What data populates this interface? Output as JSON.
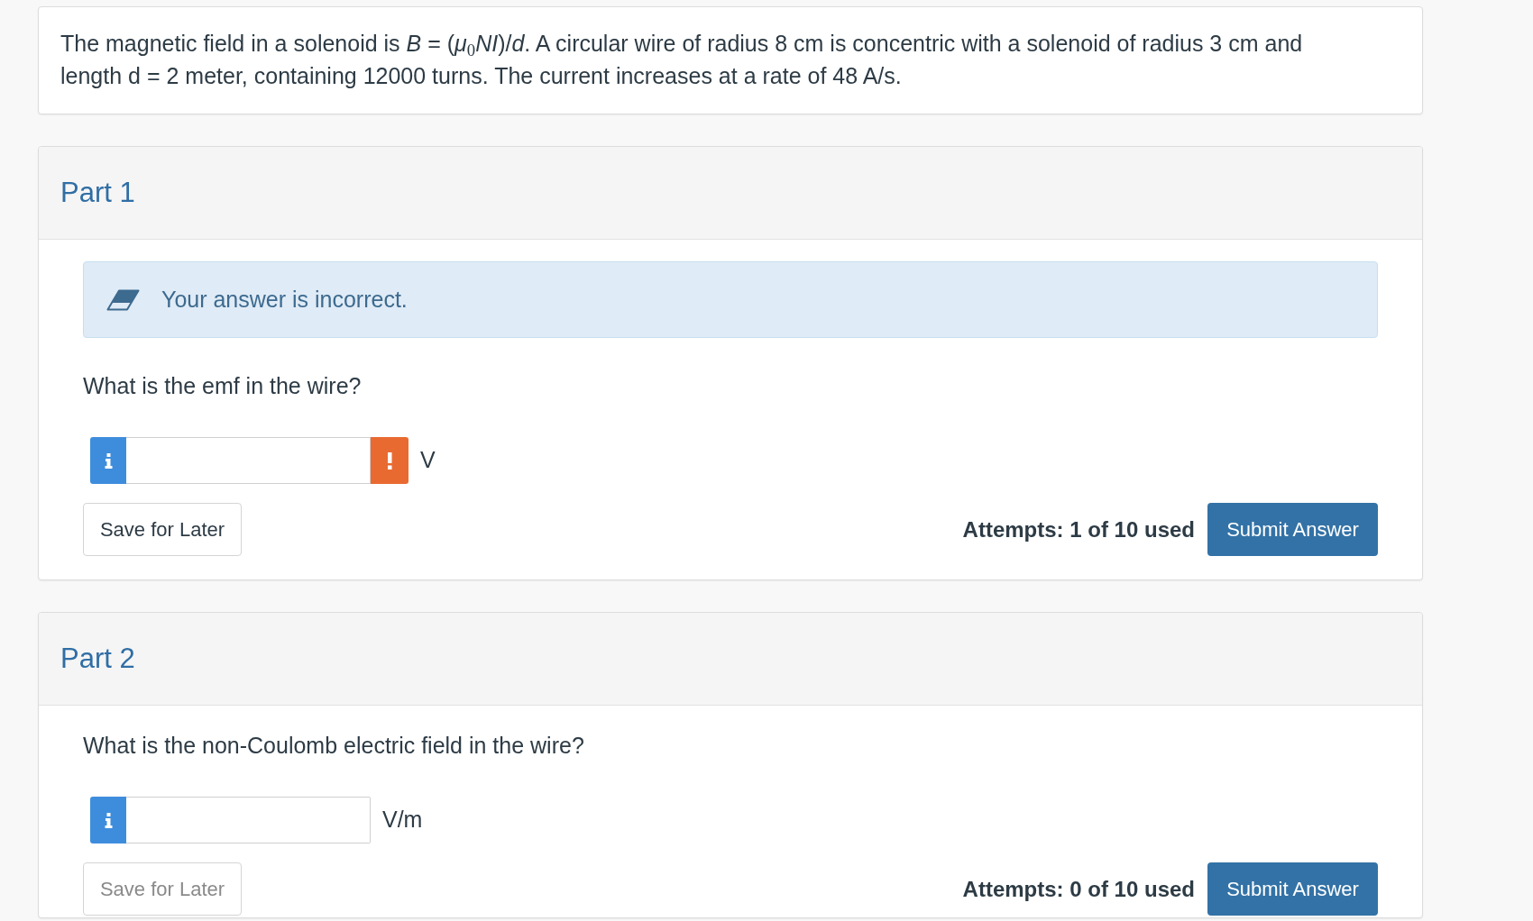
{
  "problem": {
    "text": "The magnetic field in a solenoid is *B* = (*μ*$_{0}$*NI*)/*d*. A circular wire of radius 8 cm is concentric with a solenoid of radius 3 cm and length d = 2 meter, containing 12000 turns. The current increases at a rate of 48 A/s."
  },
  "parts": [
    {
      "title": "Part 1",
      "feedback": {
        "text": "Your answer is incorrect."
      },
      "question": "What is the emf in the wire?",
      "answer": {
        "unit": "V",
        "warning": true
      },
      "save_button": {
        "label": "Save for Later",
        "disabled": false
      },
      "attempts": "Attempts: 1 of 10 used",
      "submit_button": {
        "label": "Submit Answer"
      }
    },
    {
      "title": "Part 2",
      "question": "What is the non-Coulomb electric field in the wire?",
      "answer": {
        "unit": "V/m",
        "warning": false
      },
      "save_button": {
        "label": "Save for Later",
        "disabled": true
      },
      "attempts": "Attempts: 0 of 10 used",
      "submit_button": {
        "label": "Submit Answer"
      }
    }
  ]
}
